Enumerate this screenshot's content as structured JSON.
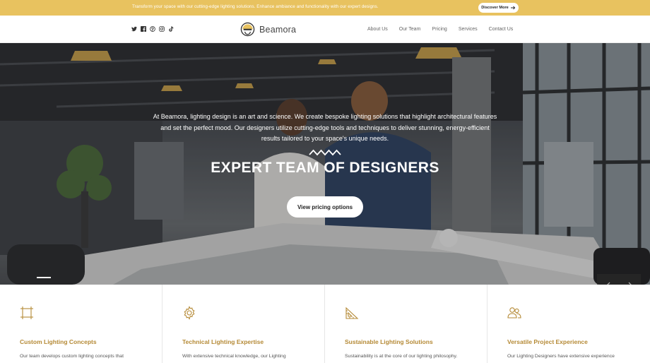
{
  "topbar": {
    "message": "Transform your space with our cutting-edge lighting solutions. Enhance ambiance and functionality with our expert designs.",
    "button_label": "Discover More"
  },
  "header": {
    "social_icons": [
      "twitter-icon",
      "facebook-icon",
      "pinterest-icon",
      "instagram-icon",
      "tiktok-icon"
    ],
    "brand": "Beamora",
    "nav": [
      "About Us",
      "Our Team",
      "Pricing",
      "Services",
      "Contact Us"
    ]
  },
  "hero": {
    "description_lines": [
      "At Beamora, lighting design is an art and science. We create bespoke lighting solutions that highlight architectural features",
      "and set the perfect mood. Our designers utilize cutting-edge tools and techniques to deliver stunning, energy-efficient",
      "results tailored to your space's unique needs."
    ],
    "title": "EXPERT TEAM OF DESIGNERS",
    "button_label": "View pricing options"
  },
  "features": [
    {
      "icon": "drafting-frame-icon",
      "title": "Custom Lighting Concepts",
      "text": "Our team develops custom lighting concepts that"
    },
    {
      "icon": "gear-icon",
      "title": "Technical Lighting Expertise",
      "text": "With extensive technical knowledge, our Lighting"
    },
    {
      "icon": "set-square-icon",
      "title": "Sustainable Lighting Solutions",
      "text": "Sustainability is at the core of our lighting philosophy."
    },
    {
      "icon": "team-icon",
      "title": "Versatile Project Experience",
      "text": "Our Lighting Designers have extensive experience"
    }
  ],
  "colors": {
    "accent": "#e8c25f",
    "feature_title": "#b58a36"
  }
}
